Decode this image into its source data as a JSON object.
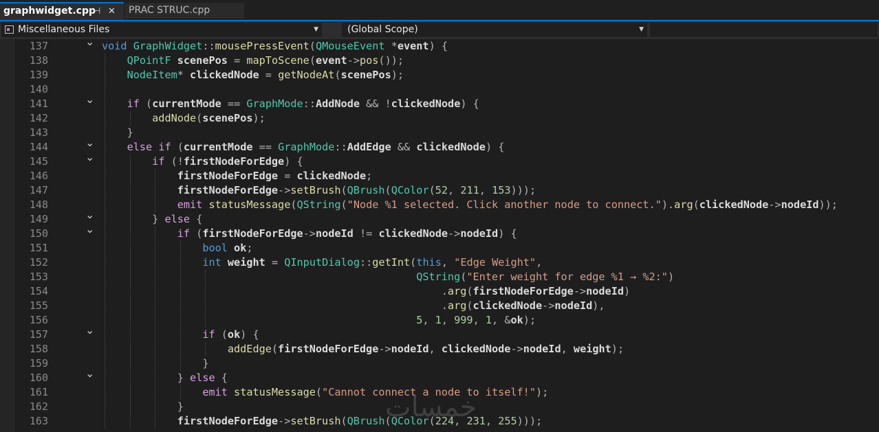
{
  "tabs": [
    {
      "label": "graphwidget.cpp",
      "active": true,
      "pin_icon": "pin-icon",
      "close_icon": "close-icon"
    },
    {
      "label": "PRAC STRUC.cpp",
      "active": false
    }
  ],
  "navigation_bar": {
    "project": "Miscellaneous Files",
    "scope": "(Global Scope)",
    "member": ""
  },
  "colors": {
    "keyword": "#569cd6",
    "control": "#d8a0df",
    "type": "#4ec9b0",
    "function": "#dcdcaa",
    "string": "#d69d85",
    "number": "#b5cea8",
    "identifier": "#dcdcdc",
    "accent": "#0078d4"
  },
  "code_lines": [
    {
      "n": "137",
      "fold": true,
      "text": "void GraphWidget::mousePressEvent(QMouseEvent *event) {"
    },
    {
      "n": "138",
      "fold": false,
      "text": "    QPointF scenePos = mapToScene(event->pos());"
    },
    {
      "n": "139",
      "fold": false,
      "text": "    NodeItem* clickedNode = getNodeAt(scenePos);"
    },
    {
      "n": "140",
      "fold": false,
      "text": ""
    },
    {
      "n": "141",
      "fold": true,
      "text": "    if (currentMode == GraphMode::AddNode && !clickedNode) {"
    },
    {
      "n": "142",
      "fold": false,
      "text": "        addNode(scenePos);"
    },
    {
      "n": "143",
      "fold": false,
      "text": "    }"
    },
    {
      "n": "144",
      "fold": true,
      "text": "    else if (currentMode == GraphMode::AddEdge && clickedNode) {"
    },
    {
      "n": "145",
      "fold": true,
      "text": "        if (!firstNodeForEdge) {"
    },
    {
      "n": "146",
      "fold": false,
      "text": "            firstNodeForEdge = clickedNode;"
    },
    {
      "n": "147",
      "fold": false,
      "text": "            firstNodeForEdge->setBrush(QBrush(QColor(52, 211, 153)));"
    },
    {
      "n": "148",
      "fold": false,
      "text": "            emit statusMessage(QString(\"Node %1 selected. Click another node to connect.\").arg(clickedNode->nodeId));"
    },
    {
      "n": "149",
      "fold": true,
      "text": "        } else {"
    },
    {
      "n": "150",
      "fold": true,
      "text": "            if (firstNodeForEdge->nodeId != clickedNode->nodeId) {"
    },
    {
      "n": "151",
      "fold": false,
      "text": "                bool ok;"
    },
    {
      "n": "152",
      "fold": false,
      "text": "                int weight = QInputDialog::getInt(this, \"Edge Weight\","
    },
    {
      "n": "153",
      "fold": false,
      "text": "                                                  QString(\"Enter weight for edge %1 → %2:\")"
    },
    {
      "n": "154",
      "fold": false,
      "text": "                                                      .arg(firstNodeForEdge->nodeId)"
    },
    {
      "n": "155",
      "fold": false,
      "text": "                                                      .arg(clickedNode->nodeId),"
    },
    {
      "n": "156",
      "fold": false,
      "text": "                                                  5, 1, 999, 1, &ok);"
    },
    {
      "n": "157",
      "fold": true,
      "text": "                if (ok) {"
    },
    {
      "n": "158",
      "fold": false,
      "text": "                    addEdge(firstNodeForEdge->nodeId, clickedNode->nodeId, weight);"
    },
    {
      "n": "159",
      "fold": false,
      "text": "                }"
    },
    {
      "n": "160",
      "fold": true,
      "text": "            } else {"
    },
    {
      "n": "161",
      "fold": false,
      "text": "                emit statusMessage(\"Cannot connect a node to itself!\");"
    },
    {
      "n": "162",
      "fold": false,
      "text": "            }"
    },
    {
      "n": "163",
      "fold": false,
      "text": "            firstNodeForEdge->setBrush(QBrush(QColor(224, 231, 255)));"
    }
  ],
  "watermark": "خمسات"
}
